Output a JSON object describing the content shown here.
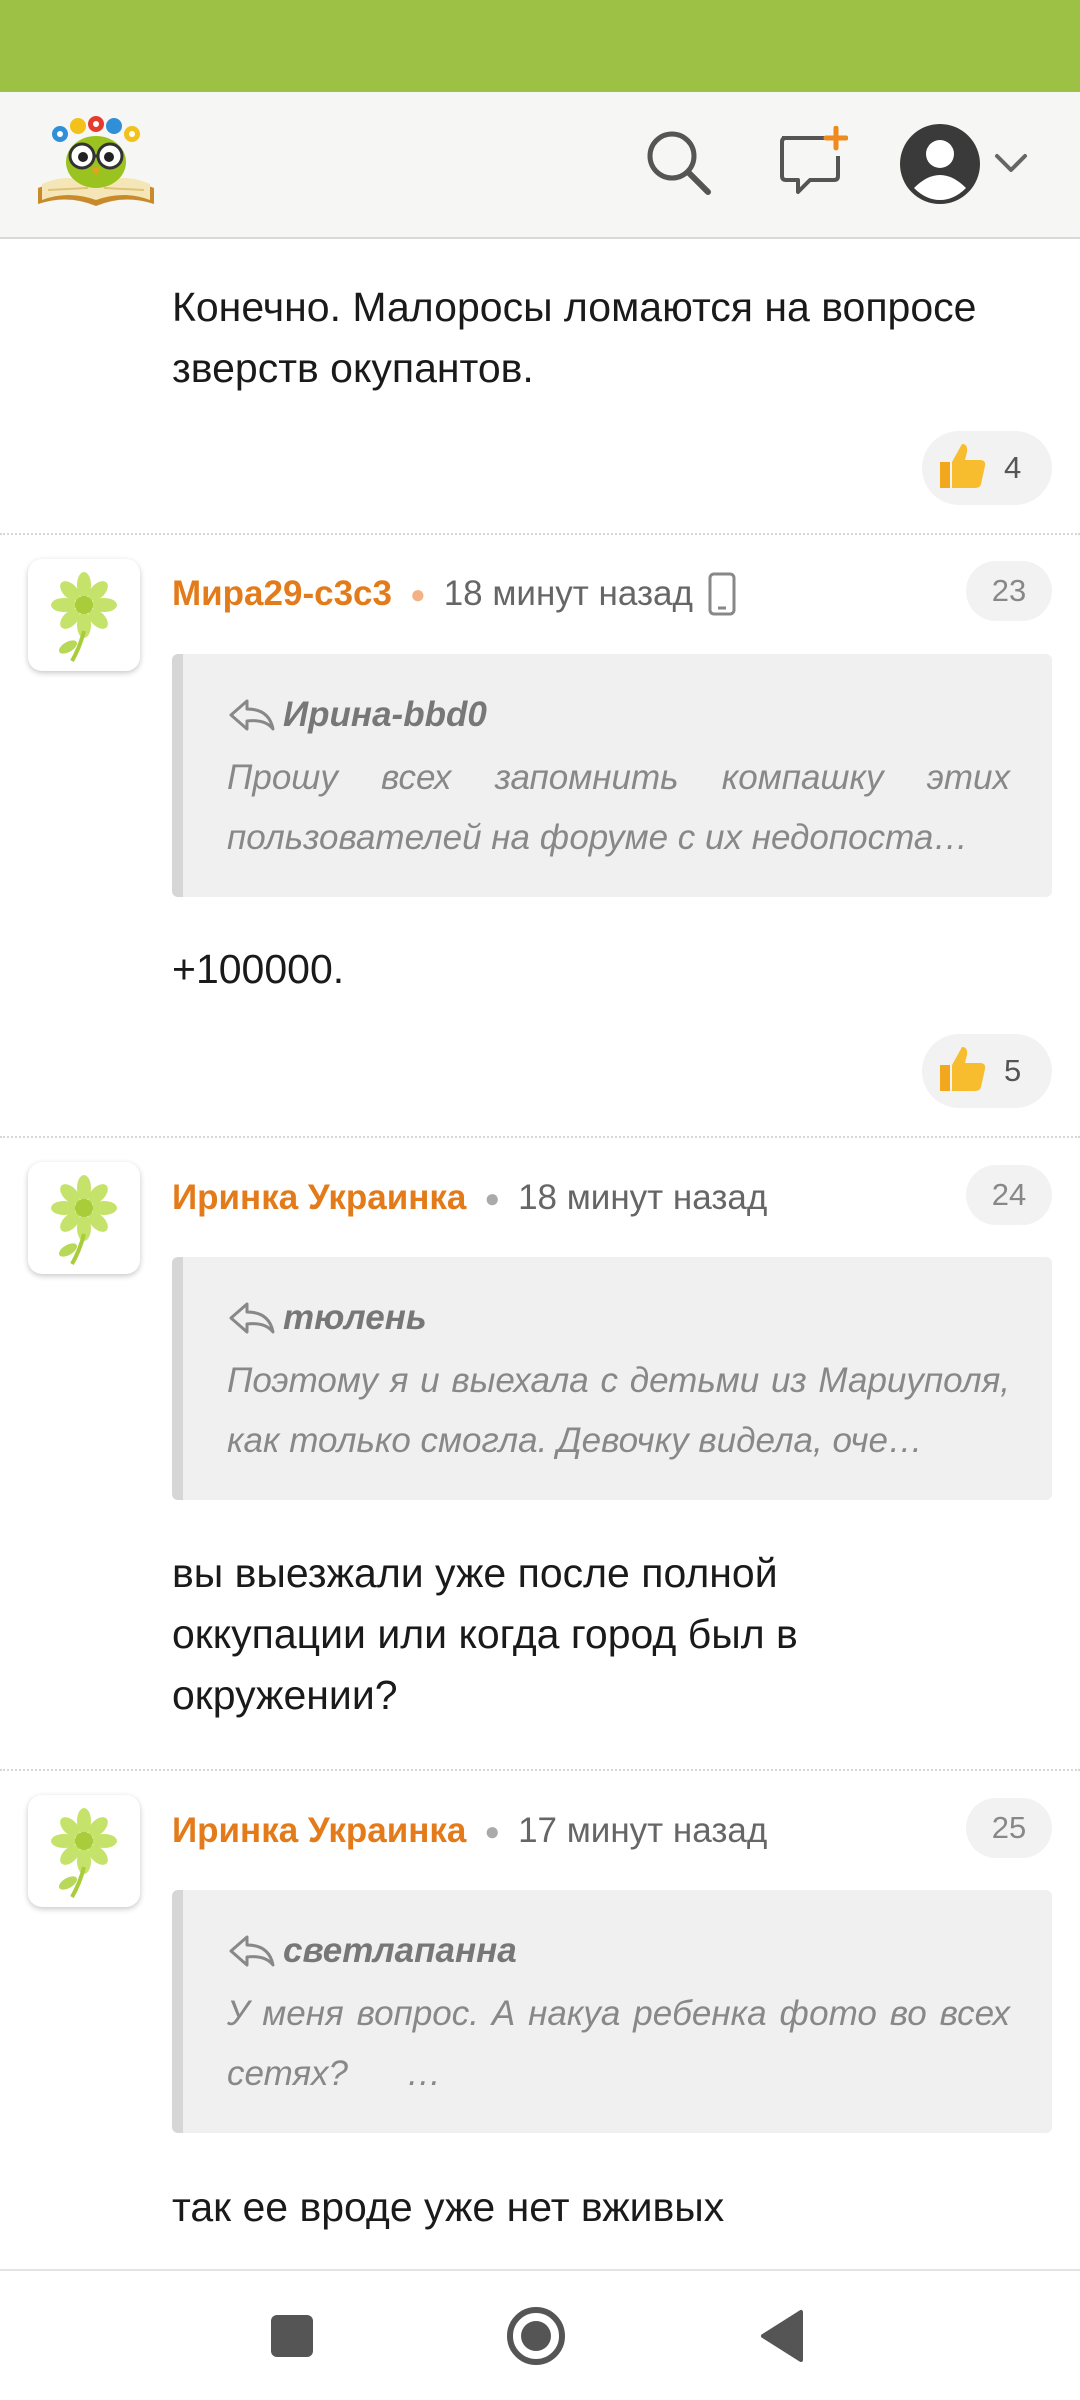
{
  "app": {
    "colors": {
      "status_bar": "#9dc145",
      "author": "#e37b1a",
      "quote_bg": "#f0f0f0"
    },
    "icons": [
      "logo-owl-book",
      "search-icon",
      "new-message-icon",
      "profile-avatar-icon",
      "chevron-down-icon"
    ]
  },
  "posts": [
    {
      "text_line1": "Конечно. Малоросы ломаются на вопросе",
      "text_line2": "зверств окупантов.",
      "likes": "4"
    },
    {
      "author": "Мира29-c3c3",
      "time": "18 минут назад",
      "device_icon": "mobile-icon",
      "number": "23",
      "quote_author": "Ирина-bbd0",
      "quote_line1": "Прошу всех запомнить компашку этих",
      "quote_line2": "пользователей на форуме с их недопоста…",
      "text": "+100000.",
      "likes": "5"
    },
    {
      "author": "Иринка Украинка",
      "time": "18 минут назад",
      "number": "24",
      "quote_author": "тюлень",
      "quote_line1": "Поэтому я и выехала с детьми из Мариуполя,",
      "quote_line2": "как только смогла. Девочку видела, оче…",
      "text_line1": "вы выезжали уже после полной",
      "text_line2": "оккупации или когда город был в",
      "text_line3": "окружении?"
    },
    {
      "author": "Иринка Украинка",
      "time": "17 минут назад",
      "number": "25",
      "quote_author": "светлапанна",
      "quote_line1": "У меня вопрос. А накуа ребенка фото во всех",
      "quote_line2": "сетях?      …",
      "text": "так ее вроде уже нет вживых"
    }
  ],
  "navbar": {
    "icons": [
      "recents-square-icon",
      "home-circle-icon",
      "back-triangle-icon"
    ]
  }
}
